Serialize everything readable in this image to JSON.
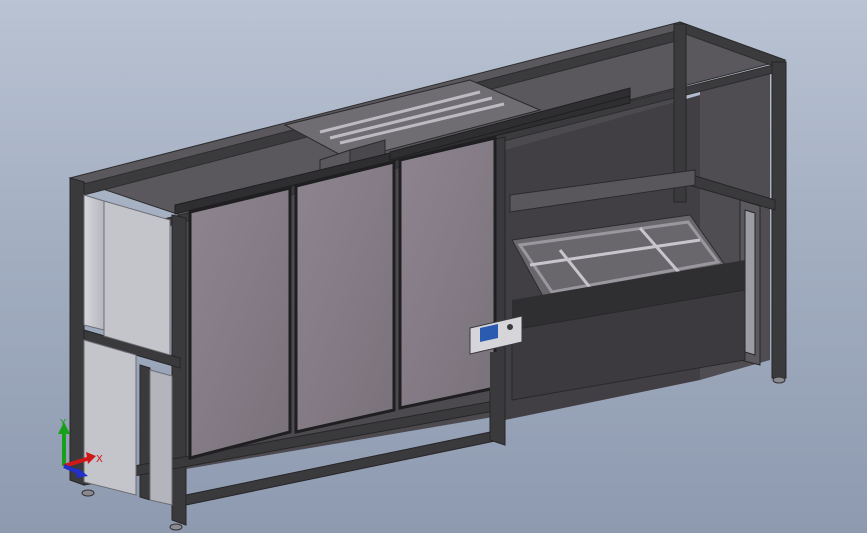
{
  "view": {
    "background_top": "#b9c3d3",
    "background_bottom": "#8e9ab0"
  },
  "triad": {
    "x_label": "X",
    "y_label": "Y",
    "x_color": "#d01818",
    "y_color": "#18a018",
    "z_color": "#2030c8"
  },
  "model": {
    "frame_color": "#3b3a3c",
    "panel_color": "#857c84",
    "side_panel_color": "#c9c9cf",
    "interior_color": "#4a474c",
    "hmi_screen_color": "#2a5bb0"
  }
}
